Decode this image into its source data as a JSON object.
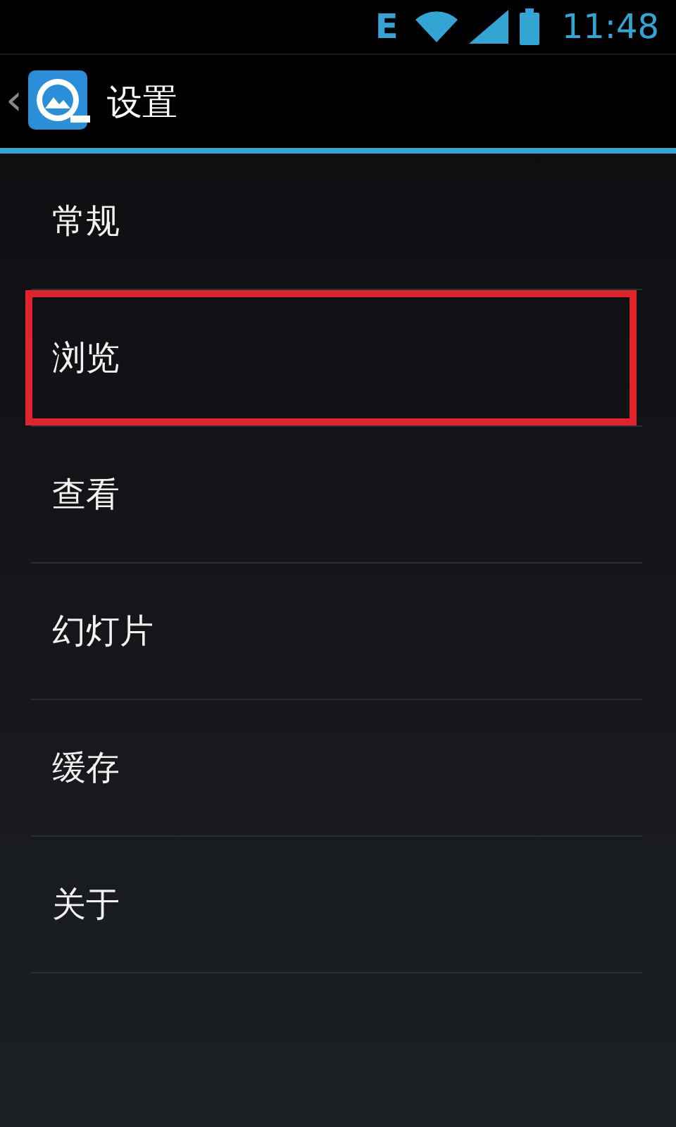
{
  "status_bar": {
    "network": "E",
    "time": "11:48"
  },
  "action_bar": {
    "back": "‹",
    "title": "设置"
  },
  "items": [
    {
      "label": "常规",
      "highlighted": false
    },
    {
      "label": "浏览",
      "highlighted": true
    },
    {
      "label": "查看",
      "highlighted": false
    },
    {
      "label": "幻灯片",
      "highlighted": false
    },
    {
      "label": "缓存",
      "highlighted": false
    },
    {
      "label": "关于",
      "highlighted": false
    }
  ]
}
